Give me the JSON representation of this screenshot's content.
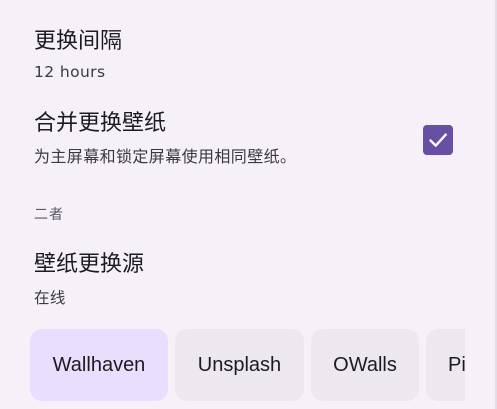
{
  "settings": {
    "interval": {
      "title": "更换间隔",
      "summary": "12 hours"
    },
    "same_wallpaper": {
      "title": "合并更换壁纸",
      "summary": "为主屏幕和锁定屏幕使用相同壁纸。",
      "checked": true
    },
    "category": "二者",
    "source": {
      "title": "壁纸更换源",
      "summary": "在线",
      "chips": [
        {
          "label": "Wallhaven",
          "selected": true
        },
        {
          "label": "Unsplash",
          "selected": false
        },
        {
          "label": "OWalls",
          "selected": false
        },
        {
          "label": "Pi",
          "selected": false
        }
      ]
    }
  },
  "colors": {
    "background": "#f6f1f8",
    "accent": "#6750a4",
    "chip_selected": "#e9defd",
    "chip": "#ede8ef"
  },
  "icons": {
    "checkbox": "check-icon"
  }
}
